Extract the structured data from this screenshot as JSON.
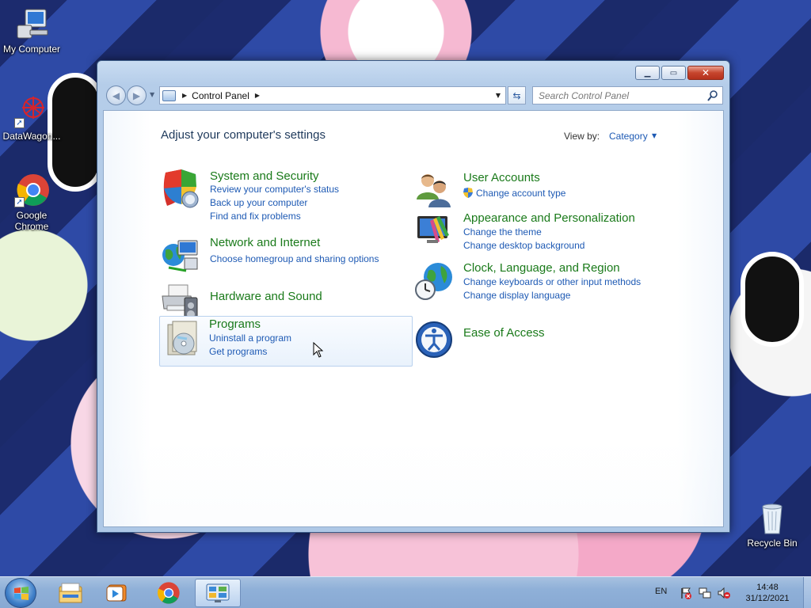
{
  "desktop": {
    "icons": [
      {
        "label": "My Computer",
        "icon": "computer-icon"
      },
      {
        "label": "DataWagon...",
        "icon": "datawagon-icon"
      },
      {
        "label": "Google Chrome",
        "icon": "chrome-icon"
      },
      {
        "label": "Recycle Bin",
        "icon": "recycle-bin-icon"
      }
    ]
  },
  "window": {
    "controls": {
      "minimize": "▁",
      "maximize": "▭",
      "close": "✕"
    },
    "address": {
      "segments": [
        "Control Panel"
      ]
    },
    "search": {
      "placeholder": "Search Control Panel"
    },
    "page_title": "Adjust your computer's settings",
    "view_by": {
      "label": "View by:",
      "value": "Category"
    }
  },
  "categories": {
    "system": {
      "title": "System and Security",
      "links": [
        "Review your computer's status",
        "Back up your computer",
        "Find and fix problems"
      ]
    },
    "network": {
      "title": "Network and Internet",
      "links": [
        "Choose homegroup and sharing options"
      ]
    },
    "hardware": {
      "title": "Hardware and Sound",
      "links": []
    },
    "programs": {
      "title": "Programs",
      "links": [
        "Uninstall a program",
        "Get programs"
      ]
    },
    "users": {
      "title": "User Accounts",
      "links": [
        "Change account type"
      ]
    },
    "appearance": {
      "title": "Appearance and Personalization",
      "links": [
        "Change the theme",
        "Change desktop background"
      ]
    },
    "clock": {
      "title": "Clock, Language, and Region",
      "links": [
        "Change keyboards or other input methods",
        "Change display language"
      ]
    },
    "ease": {
      "title": "Ease of Access",
      "links": []
    }
  },
  "taskbar": {
    "pinned": [
      "explorer-icon",
      "media-player-icon",
      "chrome-icon",
      "control-panel-icon"
    ],
    "active": "control-panel-icon",
    "language": "EN",
    "tray_icons": [
      "action-center-flag-icon",
      "network-icon",
      "volume-muted-icon"
    ],
    "time": "14:48",
    "date": "31/12/2021"
  }
}
